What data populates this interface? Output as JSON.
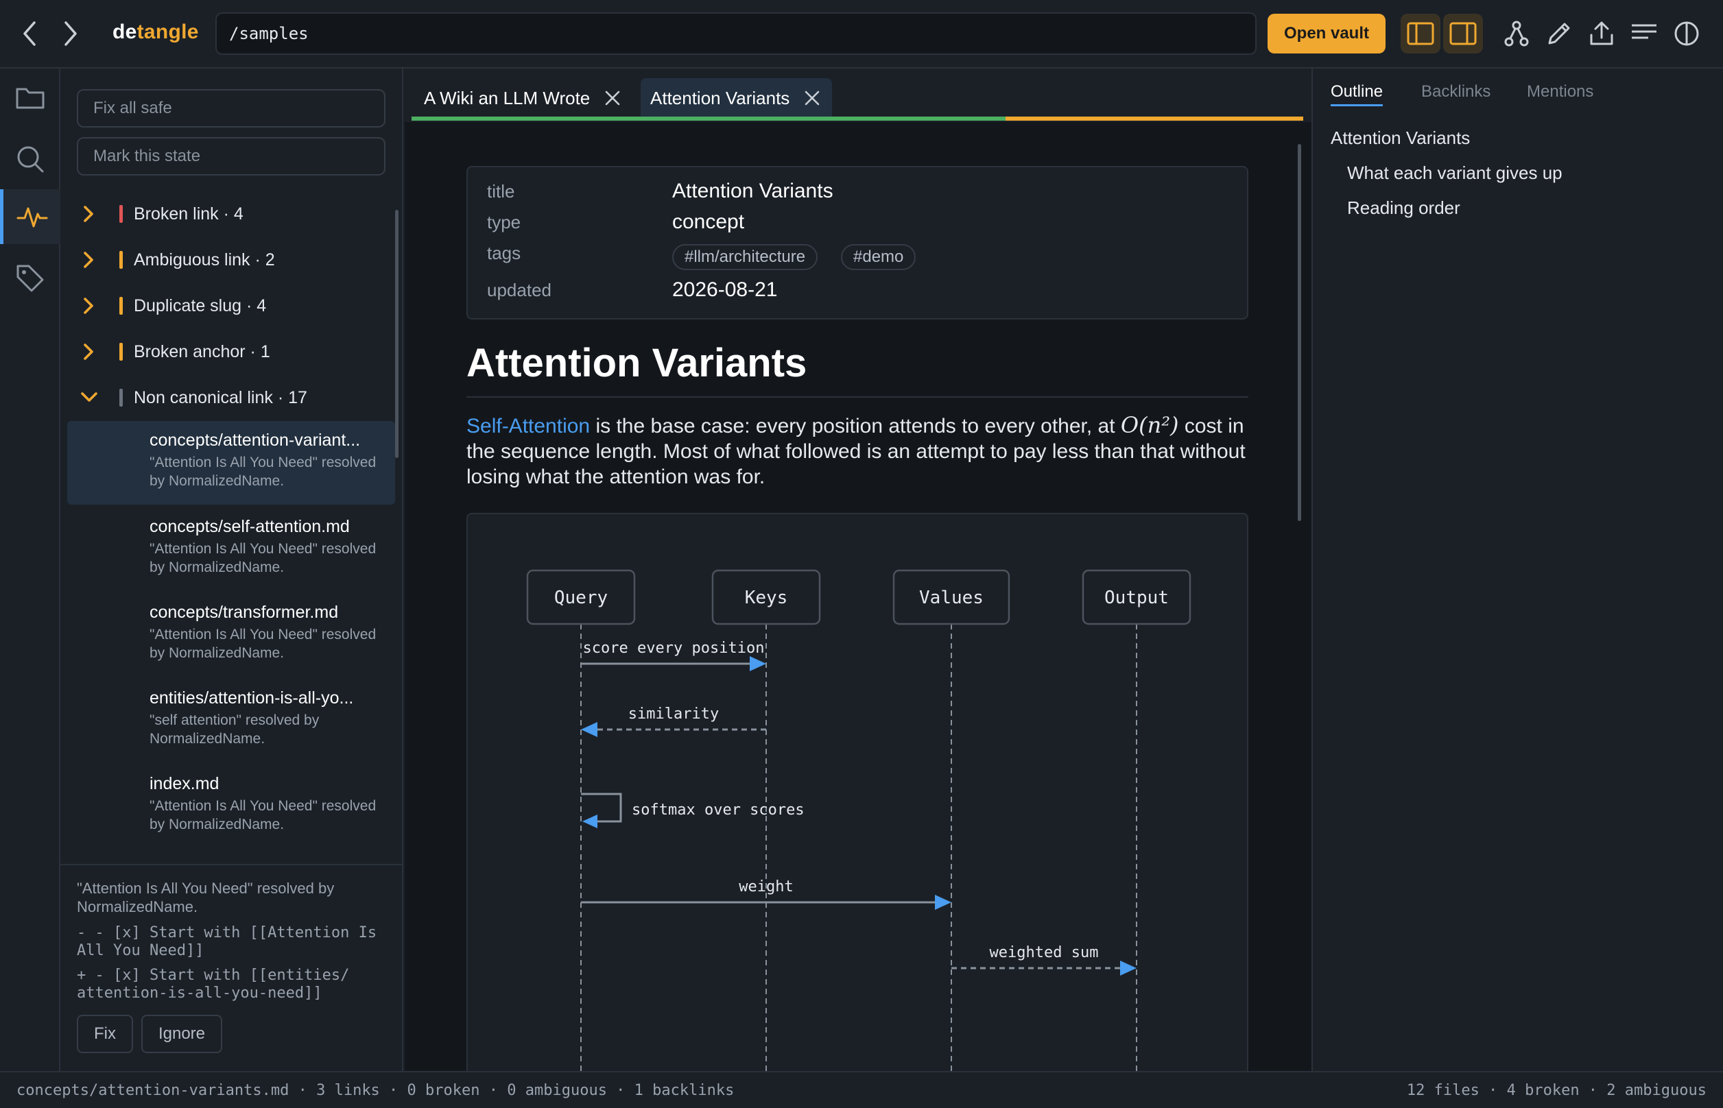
{
  "brand": {
    "part1": "de",
    "part2": "tangle"
  },
  "topbar": {
    "path_value": "/samples",
    "open_vault_label": "Open vault"
  },
  "left_panel": {
    "fix_all_placeholder": "Fix all safe",
    "mark_state_placeholder": "Mark this state",
    "groups": [
      {
        "label": "Broken link · 4",
        "color": "#e05555",
        "expanded": false
      },
      {
        "label": "Ambiguous link · 2",
        "color": "#f0a830",
        "expanded": false
      },
      {
        "label": "Duplicate slug · 4",
        "color": "#f0a830",
        "expanded": false
      },
      {
        "label": "Broken anchor · 1",
        "color": "#f0a830",
        "expanded": false
      },
      {
        "label": "Non canonical link · 17",
        "color": "#6b737d",
        "expanded": true
      }
    ],
    "items": [
      {
        "title": "concepts/attention-variant...",
        "desc": "\"Attention Is All You Need\" resolved by NormalizedName."
      },
      {
        "title": "concepts/self-attention.md",
        "desc": "\"Attention Is All You Need\" resolved by NormalizedName."
      },
      {
        "title": "concepts/transformer.md",
        "desc": "\"Attention Is All You Need\" resolved by NormalizedName."
      },
      {
        "title": "entities/attention-is-all-yo...",
        "desc": "\"self attention\" resolved by NormalizedName."
      },
      {
        "title": "index.md",
        "desc": "\"Attention Is All You Need\" resolved by NormalizedName."
      }
    ],
    "detail": {
      "message": "\"Attention Is All You Need\" resolved by NormalizedName.",
      "diff_minus": "- - [x] Start with [[Attention Is All You Need]]",
      "diff_plus": "+ - [x] Start with [[entities/ attention-is-all-you-need]]",
      "fix_label": "Fix",
      "ignore_label": "Ignore"
    }
  },
  "editor": {
    "tabs": [
      {
        "label": "A Wiki an LLM Wrote",
        "active": false
      },
      {
        "label": "Attention Variants",
        "active": true
      }
    ],
    "properties": {
      "title_key": "title",
      "title_val": "Attention Variants",
      "type_key": "type",
      "type_val": "concept",
      "tags_key": "tags",
      "tags": [
        "#llm/architecture",
        "#demo"
      ],
      "updated_key": "updated",
      "updated_val": "2026-08-21"
    },
    "heading": "Attention Variants",
    "paragraph": {
      "link": "Self-Attention",
      "text1": " is the base case: every position attends to every other, at ",
      "math": "O(n²)",
      "text2": " cost in the sequence length. Most of what followed is an attempt to pay less than that without losing what the attention was for."
    },
    "diagram": {
      "participants": [
        "Query",
        "Keys",
        "Values",
        "Output"
      ],
      "messages": [
        {
          "from": 0,
          "to": 1,
          "label": "score every position",
          "style": "solid"
        },
        {
          "from": 1,
          "to": 0,
          "label": "similarity",
          "style": "dashed"
        },
        {
          "from": 0,
          "to": 0,
          "label": "softmax over scores",
          "style": "self"
        },
        {
          "from": 0,
          "to": 2,
          "label": "weight",
          "style": "solid"
        },
        {
          "from": 2,
          "to": 3,
          "label": "weighted sum",
          "style": "dashed"
        }
      ]
    }
  },
  "right_panel": {
    "tabs": [
      "Outline",
      "Backlinks",
      "Mentions"
    ],
    "active_tab": "Outline",
    "outline": [
      {
        "label": "Attention Variants",
        "level": 1
      },
      {
        "label": "What each variant gives up",
        "level": 2
      },
      {
        "label": "Reading order",
        "level": 2
      }
    ]
  },
  "statusbar": {
    "left": "concepts/attention-variants.md · 3 links · 0 broken · 0 ambiguous · 1 backlinks",
    "right": "12 files · 4 broken · 2 ambiguous"
  },
  "colors": {
    "accent": "#f0a830",
    "link": "#4a9df0",
    "tab_progress_green": "#4caf62",
    "tab_progress_orange": "#f0a830"
  }
}
